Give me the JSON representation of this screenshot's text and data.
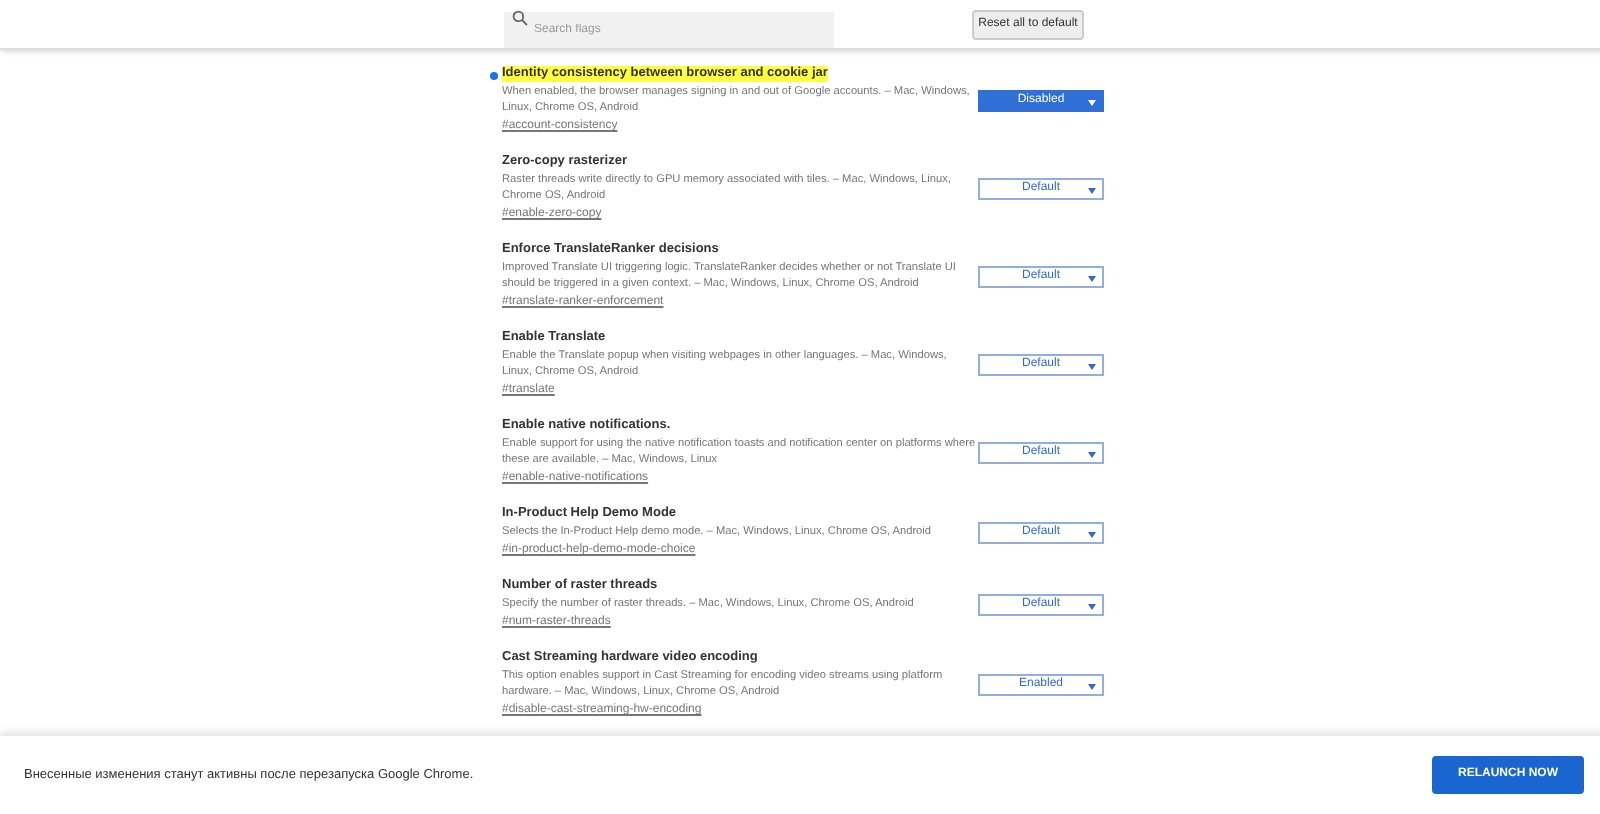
{
  "search": {
    "placeholder": "Search flags"
  },
  "reset_button": "Reset all to default",
  "flags": [
    {
      "title": "Identity consistency between browser and cookie jar",
      "description": "When enabled, the browser manages signing in and out of Google accounts. – Mac, Windows, Linux, Chrome OS, Android",
      "link": "#account-consistency",
      "value": "Disabled",
      "modified": true,
      "highlighted": true
    },
    {
      "title": "Zero-copy rasterizer",
      "description": "Raster threads write directly to GPU memory associated with tiles. – Mac, Windows, Linux, Chrome OS, Android",
      "link": "#enable-zero-copy",
      "value": "Default",
      "modified": false,
      "highlighted": false
    },
    {
      "title": "Enforce TranslateRanker decisions",
      "description": "Improved Translate UI triggering logic. TranslateRanker decides whether or not Translate UI should be triggered in a given context. – Mac, Windows, Linux, Chrome OS, Android",
      "link": "#translate-ranker-enforcement",
      "value": "Default",
      "modified": false,
      "highlighted": false
    },
    {
      "title": "Enable Translate",
      "description": "Enable the Translate popup when visiting webpages in other languages. – Mac, Windows, Linux, Chrome OS, Android",
      "link": "#translate",
      "value": "Default",
      "modified": false,
      "highlighted": false
    },
    {
      "title": "Enable native notifications.",
      "description": "Enable support for using the native notification toasts and notification center on platforms where these are available. – Mac, Windows, Linux",
      "link": "#enable-native-notifications",
      "value": "Default",
      "modified": false,
      "highlighted": false
    },
    {
      "title": "In-Product Help Demo Mode",
      "description": "Selects the In-Product Help demo mode. – Mac, Windows, Linux, Chrome OS, Android",
      "link": "#in-product-help-demo-mode-choice",
      "value": "Default",
      "modified": false,
      "highlighted": false
    },
    {
      "title": "Number of raster threads",
      "description": "Specify the number of raster threads. – Mac, Windows, Linux, Chrome OS, Android",
      "link": "#num-raster-threads",
      "value": "Default",
      "modified": false,
      "highlighted": false
    },
    {
      "title": "Cast Streaming hardware video encoding",
      "description": "This option enables support in Cast Streaming for encoding video streams using platform hardware. – Mac, Windows, Linux, Chrome OS, Android",
      "link": "#disable-cast-streaming-hw-encoding",
      "value": "Enabled",
      "modified": false,
      "highlighted": false
    }
  ],
  "relaunch": {
    "message": "Внесенные изменения станут активны после перезапуска Google Chrome.",
    "button": "RELAUNCH NOW"
  }
}
